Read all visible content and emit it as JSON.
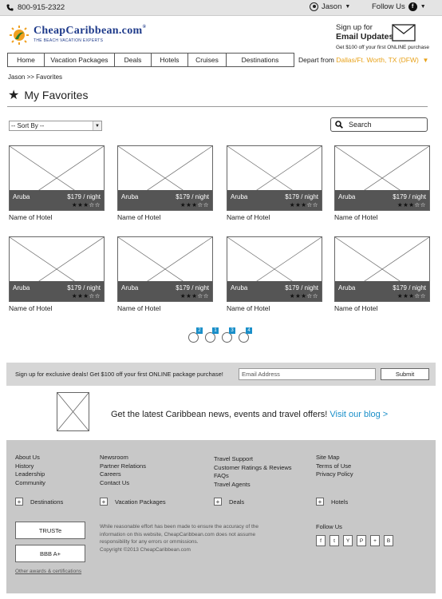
{
  "topbar": {
    "phone": "800-915-2322",
    "user": "Jason",
    "follow": "Follow Us",
    "fb": "f"
  },
  "logo": {
    "name": "CheapCaribbean.com",
    "reg": "®",
    "tagline": "THE BEACH VACATION EXPERTS"
  },
  "signup_promo": {
    "line1": "Sign up for",
    "line2": "Email Updates",
    "line3": "Get $100 off your first ONLINE purchase"
  },
  "nav": [
    {
      "label": "Home"
    },
    {
      "label": "Vacation Packages"
    },
    {
      "label": "Deals"
    },
    {
      "label": "Hotels"
    },
    {
      "label": "Cruises"
    },
    {
      "label": "Destinations"
    }
  ],
  "depart": {
    "label": "Depart from",
    "city": "Dallas/Ft. Worth, TX (DFW)"
  },
  "breadcrumb": "Jason >> Favorites",
  "page_title": "My Favorites",
  "sort": {
    "label": "-- Sort By --"
  },
  "search": {
    "placeholder": "Search"
  },
  "cards": [
    {
      "location": "Aruba",
      "price": "$179 / night",
      "rating": 3,
      "name": "Name of Hotel"
    },
    {
      "location": "Aruba",
      "price": "$179 / night",
      "rating": 3,
      "name": "Name of Hotel"
    },
    {
      "location": "Aruba",
      "price": "$179 / night",
      "rating": 3,
      "name": "Name of Hotel"
    },
    {
      "location": "Aruba",
      "price": "$179 / night",
      "rating": 3,
      "name": "Name of Hotel"
    },
    {
      "location": "Aruba",
      "price": "$179 / night",
      "rating": 3,
      "name": "Name of Hotel"
    },
    {
      "location": "Aruba",
      "price": "$179 / night",
      "rating": 3,
      "name": "Name of Hotel"
    },
    {
      "location": "Aruba",
      "price": "$179 / night",
      "rating": 3,
      "name": "Name of Hotel"
    },
    {
      "location": "Aruba",
      "price": "$179 / night",
      "rating": 3,
      "name": "Name of Hotel"
    }
  ],
  "pager": [
    "2",
    "1",
    "3",
    "4"
  ],
  "newsletter": {
    "message": "Sign up for exclusive deals! Get $100 off your first ONLINE package purchase!",
    "placeholder": "Email Address",
    "submit": "Submit"
  },
  "blog": {
    "text": "Get the latest Caribbean news, events and travel offers!",
    "link": "Visit our blog >"
  },
  "footer": {
    "col1": [
      "About Us",
      "History",
      "Leadership",
      "Community"
    ],
    "col2": [
      "Newsroom",
      "Partner Relations",
      "Careers",
      "Contact Us"
    ],
    "col3": [
      "Travel Support",
      "Customer Ratings & Reviews",
      "FAQs",
      "Travel Agents"
    ],
    "col4": [
      "Site Map",
      "Terms of Use",
      "Privacy Policy"
    ],
    "categories": [
      "Destinations",
      "Vacation Packages",
      "Deals",
      "Hotels"
    ],
    "badges": [
      "TRUSTe",
      "BBB A+"
    ],
    "awards": "Other awards & certifications",
    "disclaimer": "While reasonable effort has been made to ensure the accuracy of the information on this website, CheapCaribbean.com does not assume responsibility for any errors or ommissions.",
    "copyright": "Copyright ©2013 CheapCaribbean.com",
    "follow": "Follow Us",
    "social": [
      "f",
      "t",
      "Y",
      "P",
      "+",
      "B"
    ]
  },
  "colors": {
    "accent_orange": "#e8a21a",
    "link_blue": "#1a8fc9",
    "logo_blue": "#1e3a8a"
  }
}
